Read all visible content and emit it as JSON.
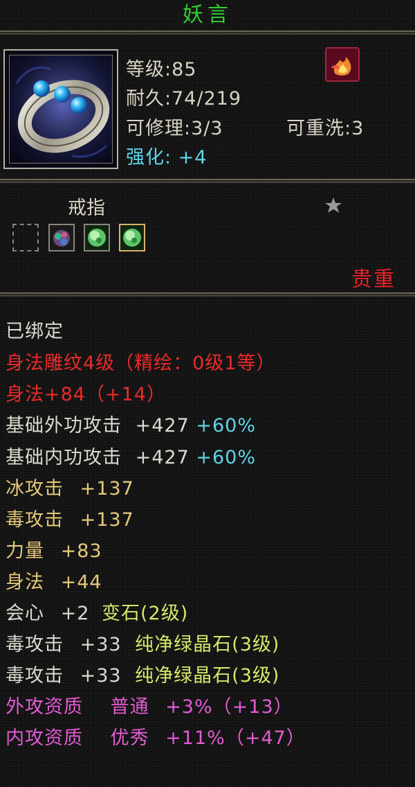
{
  "item": {
    "name": "妖言",
    "level": "等级:85",
    "durability": "耐久:74/219",
    "repairable": "可修理:3/3",
    "rewash": "可重洗:3",
    "enhance": "强化: +4",
    "type": "戒指",
    "rarity": "贵重",
    "colors": {
      "name": "#2ed12e",
      "rarity": "#e8232a",
      "white": "#dedad0",
      "red": "#ea2a2a",
      "gold": "#e6c97a",
      "cyan": "#5fd4e6",
      "yellow_green": "#d9e86a",
      "pink": "#e35bd2"
    },
    "icons": [
      "ring-icon",
      "flame-badge-icon",
      "star-icon"
    ],
    "gem_slots": [
      {
        "state": "empty"
      },
      {
        "state": "gem",
        "gem": "multicolor"
      },
      {
        "state": "gem",
        "gem": "green"
      },
      {
        "state": "gem",
        "gem": "green",
        "highlight": true
      }
    ]
  },
  "attributes": {
    "bound": "已绑定",
    "engrave": "身法雕纹4级（精绘：0级1等）",
    "agility_main": "身法+84（+14）",
    "ext_attack_label": "基础外功攻击",
    "ext_attack_val": "+427",
    "ext_attack_pct": "+60%",
    "int_attack_label": "基础内功攻击",
    "int_attack_val": "+427",
    "int_attack_pct": "+60%",
    "ice_label": "冰攻击",
    "ice_val": "+137",
    "poison_label": "毒攻击",
    "poison_val": "+137",
    "str_label": "力量",
    "str_val": "+83",
    "agi_label": "身法",
    "agi_val": "+44",
    "crit_label": "会心",
    "crit_val": "+2",
    "crit_gem": "变石(2级)",
    "gem1_label": "毒攻击",
    "gem1_val": "+33",
    "gem1_gem": "纯净绿晶石(3级)",
    "gem2_label": "毒攻击",
    "gem2_val": "+33",
    "gem2_gem": "纯净绿晶石(3级)",
    "ext_apt_label": "外攻资质",
    "ext_apt_grade": "普通",
    "ext_apt_val": "+3%（+13）",
    "int_apt_label": "内攻资质",
    "int_apt_grade": "优秀",
    "int_apt_val": "+11%（+47）"
  }
}
